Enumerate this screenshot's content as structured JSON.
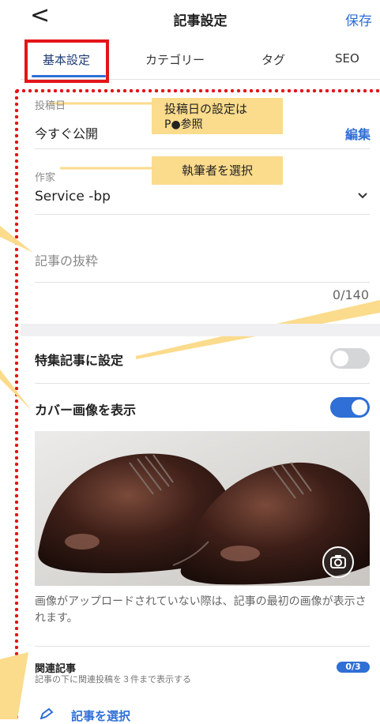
{
  "header": {
    "back_icon": "chevron-left-icon",
    "back_glyph": "<",
    "title": "記事設定",
    "save_label": "保存"
  },
  "tabs": [
    {
      "label": "基本設定",
      "active": true
    },
    {
      "label": "カテゴリー",
      "active": false
    },
    {
      "label": "タグ",
      "active": false
    },
    {
      "label": "SEO",
      "active": false
    }
  ],
  "post_date": {
    "label": "投稿日",
    "value": "今すぐ公開",
    "edit_label": "編集"
  },
  "author": {
    "label": "作家",
    "value": "Service -bp",
    "chevron_icon": "chevron-down-icon"
  },
  "excerpt": {
    "placeholder": "記事の抜粋",
    "counter": "0/140"
  },
  "featured": {
    "label": "特集記事に設定",
    "on": false
  },
  "cover": {
    "label": "カバー画像を表示",
    "on": true,
    "image_alt": "shoes-photo",
    "camera_icon": "camera-icon"
  },
  "note": "画像がアップロードされていない際は、記事の最初の画像が表示されます。",
  "related": {
    "title": "関連記事",
    "subtitle": "記事の下に関連投稿を３件まで表示する",
    "badge": "0/3",
    "select_label": "記事を選択",
    "pencil_icon": "pencil-icon"
  },
  "callouts": {
    "post_date_note_1": "投稿日の設定は",
    "post_date_note_2": "P●参照",
    "author_note": "執筆者を選択"
  },
  "colors": {
    "accent": "#2f6fd6",
    "annotation_red": "#e3151a",
    "annotation_yellow": "#fbdb8c"
  }
}
